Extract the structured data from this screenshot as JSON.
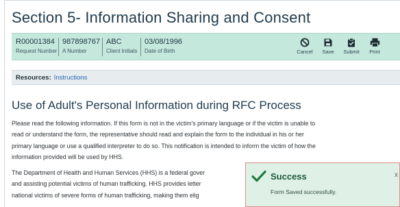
{
  "header": {
    "title": "Section 5- Information Sharing and Consent"
  },
  "info_bar": {
    "items": [
      {
        "value": "R00001384",
        "label": "Request Number"
      },
      {
        "value": "987898767",
        "label": "A Number"
      },
      {
        "value": "ABC",
        "label": "Client Initials"
      },
      {
        "value": "03/08/1996",
        "label": "Date of Birth"
      }
    ],
    "actions": [
      {
        "label": "Cancel",
        "icon": "cancel-icon"
      },
      {
        "label": "Save",
        "icon": "save-icon"
      },
      {
        "label": "Submit",
        "icon": "submit-icon"
      },
      {
        "label": "Print",
        "icon": "print-icon"
      }
    ]
  },
  "resources": {
    "label": "Resources:",
    "link": "Instructions"
  },
  "content": {
    "heading": "Use of Adult's Personal Information during RFC Process",
    "para1_lines": [
      "Please read the following information. If this form is not in the victim's primary language or if the victim is unable to",
      "read or understand the form, the representative should read and explain the form to the individual in his or her",
      "primary language or use a qualified interpreter to do so. This notification is intended to inform the victim of how the",
      "information provided will be used by HHS."
    ],
    "para2_lines": [
      "The Department of Health and Human Services (HHS) is a federal gover",
      "and assisting potential victims of human trafficking. HHS provides letter",
      "national victims of severe forms of human trafficking, making them elig"
    ]
  },
  "toast": {
    "title": "Success",
    "message": "Form Saved successfully.",
    "close": "x"
  },
  "colors": {
    "info_bar_bg": "#c5e8dc",
    "toast_bg": "#dff1e7",
    "toast_border": "#e08b8b",
    "link": "#2167b1"
  }
}
